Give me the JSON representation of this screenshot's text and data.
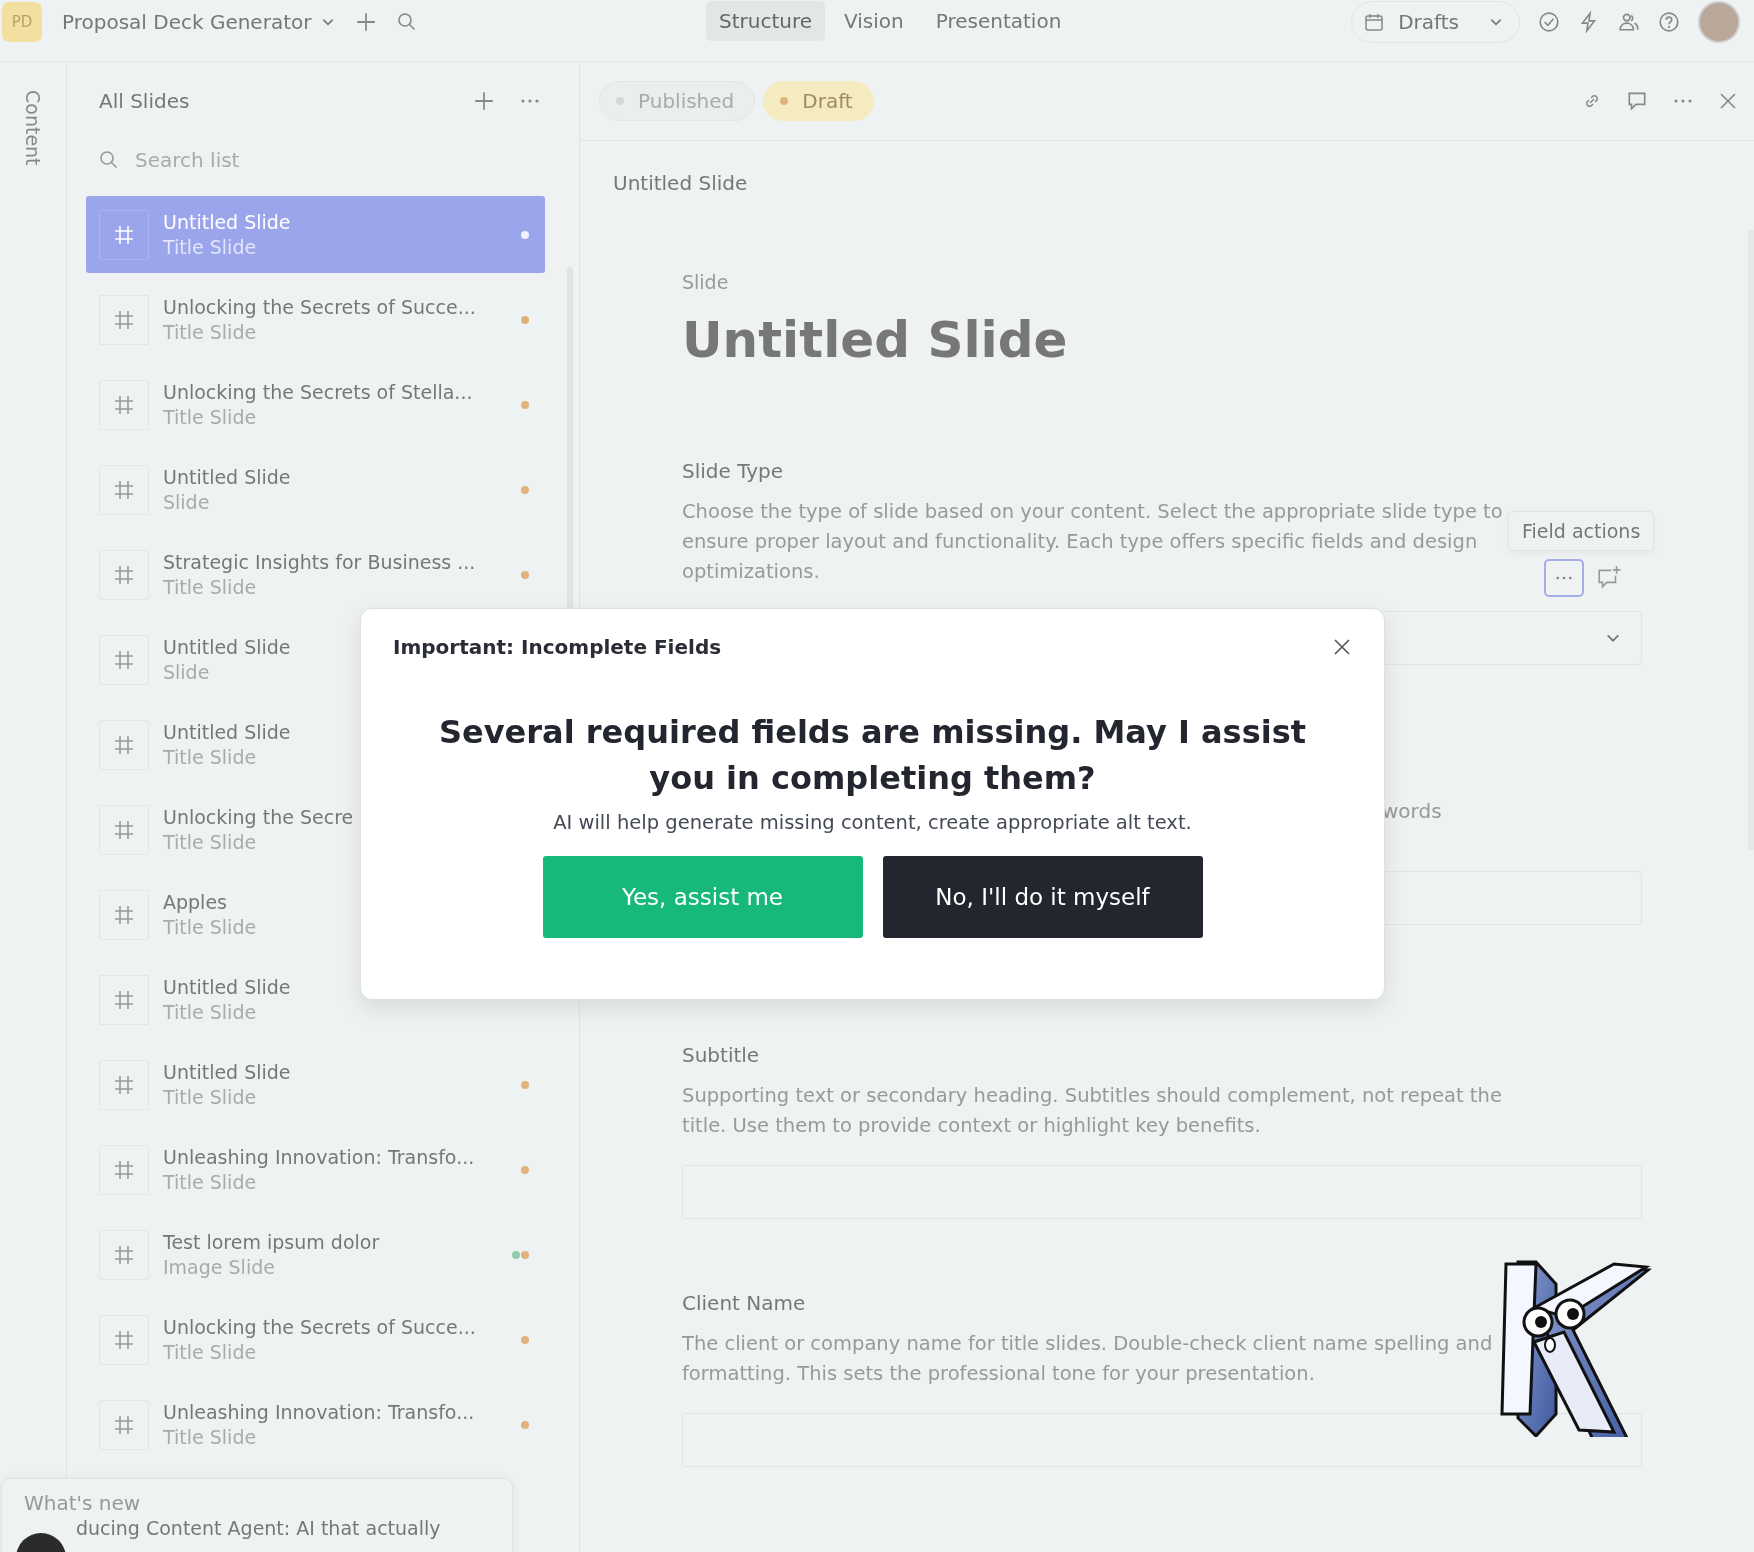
{
  "topbar": {
    "badge": "PD",
    "project": "Proposal Deck Generator",
    "tabs": [
      {
        "label": "Structure",
        "selected": true
      },
      {
        "label": "Vision",
        "selected": false
      },
      {
        "label": "Presentation",
        "selected": false
      }
    ],
    "view": "Drafts"
  },
  "side_tab": "Content",
  "sidebar": {
    "title": "All Slides",
    "search": {
      "placeholder": "Search list"
    },
    "slides": [
      {
        "title": "Untitled Slide",
        "type": "Title Slide",
        "selected": true,
        "dots": [
          {
            "color": "#f3f0ff"
          }
        ]
      },
      {
        "title": "Unlocking the Secrets of Succe...",
        "type": "Title Slide",
        "selected": false,
        "dots": [
          {
            "color": "#e2b27c"
          }
        ]
      },
      {
        "title": "Unlocking the Secrets of Stella...",
        "type": "Title Slide",
        "selected": false,
        "dots": [
          {
            "color": "#e2b27c"
          }
        ]
      },
      {
        "title": "Untitled Slide",
        "type": "Slide",
        "selected": false,
        "dots": [
          {
            "color": "#e2b27c"
          }
        ]
      },
      {
        "title": "Strategic Insights for Business ...",
        "type": "Title Slide",
        "selected": false,
        "dots": [
          {
            "color": "#e2b27c"
          }
        ]
      },
      {
        "title": "Untitled Slide",
        "type": "Slide",
        "selected": false
      },
      {
        "title": "Untitled Slide",
        "type": "Title Slide",
        "selected": false
      },
      {
        "title": "Unlocking the Secre",
        "type": "Title Slide",
        "selected": false
      },
      {
        "title": "Apples",
        "type": "Title Slide",
        "selected": false
      },
      {
        "title": "Untitled Slide",
        "type": "Title Slide",
        "selected": false
      },
      {
        "title": "Untitled Slide",
        "type": "Title Slide",
        "selected": false,
        "dots": [
          {
            "color": "#e2b27c"
          }
        ]
      },
      {
        "title": "Unleashing Innovation: Transfo...",
        "type": "Title Slide",
        "selected": false,
        "dots": [
          {
            "color": "#e2b27c"
          }
        ]
      },
      {
        "title": "Test lorem ipsum dolor",
        "type": "Image Slide",
        "selected": false,
        "dots": [
          {
            "color": "#8fcfa9"
          },
          {
            "color": "#e2b27c"
          }
        ]
      },
      {
        "title": "Unlocking the Secrets of Succe...",
        "type": "Title Slide",
        "selected": false,
        "dots": [
          {
            "color": "#e2b27c"
          }
        ]
      },
      {
        "title": "Unleashing Innovation: Transfo...",
        "type": "Title Slide",
        "selected": false,
        "dots": [
          {
            "color": "#e2b27c"
          }
        ]
      }
    ]
  },
  "whats_new": {
    "title": "What's new",
    "text": "ducing Content Agent: AI that actually"
  },
  "editor": {
    "statuses": [
      {
        "label": "Published",
        "selected": false
      },
      {
        "label": "Draft",
        "selected": true
      }
    ],
    "breadcrumb": "Untitled Slide",
    "label": "Slide",
    "heading": "Untitled Slide",
    "fields": [
      {
        "kind": "select",
        "label": "Slide Type",
        "description": "Choose the type of slide based on your content. Select the appropriate slide type to ensure proper layout and functionality. Each type offers specific fields and design optimizations.",
        "tooltip": "Field actions"
      },
      {
        "kind": "text",
        "hint": "words"
      },
      {
        "kind": "text",
        "label": "Subtitle",
        "description": "Supporting text or secondary heading. Subtitles should complement, not repeat the title. Use them to provide context or highlight key benefits."
      },
      {
        "kind": "text",
        "label": "Client Name",
        "description": "The client or company name for title slides. Double-check client name spelling and formatting. This sets the professional tone for your presentation."
      }
    ]
  },
  "dialog": {
    "title": "Important: Incomplete Fields",
    "question": "Several required fields are missing. May I assist you in completing them?",
    "text": "AI will help generate missing content, create appropriate alt text.",
    "buttons": [
      {
        "kind": "primary",
        "label": "Yes, assist me"
      },
      {
        "kind": "secondary",
        "label": "No, I'll do it myself"
      }
    ]
  }
}
